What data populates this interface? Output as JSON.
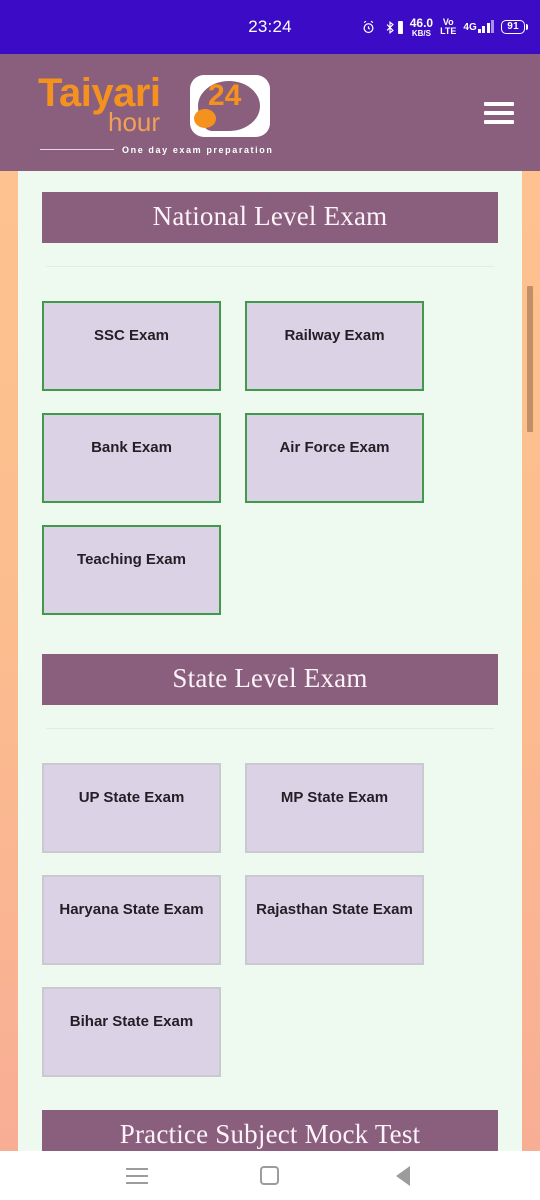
{
  "status_bar": {
    "time": "23:24",
    "alarm_icon": "alarm-clock-icon",
    "bluetooth_icon": "bluetooth-icon",
    "net_speed_value": "46.0",
    "net_speed_unit": "KB/S",
    "volte_line1": "Vo",
    "volte_line2": "LTE",
    "network_type": "4G",
    "battery_percent": "91",
    "background_color": "#3c0bc6"
  },
  "header": {
    "logo_name": "Taiyari",
    "logo_sub": "hour",
    "logo_badge_number": "24",
    "logo_tagline": "One day exam preparation",
    "menu_icon": "hamburger-menu-icon",
    "background_color": "#8a5f7e",
    "brand_orange": "#f5921e"
  },
  "page": {
    "background_color": "#eefaf0",
    "edge_gradient_color": "#fcbd8e",
    "card_fill": "#dcd2e6",
    "card_border_green": "#3f9b4b",
    "card_border_grey": "#c9c9cf",
    "banner_color": "#8a5f7e"
  },
  "sections": [
    {
      "title": "National Level Exam",
      "border_style": "green",
      "cards": [
        {
          "label": "SSC Exam"
        },
        {
          "label": "Railway Exam"
        },
        {
          "label": "Bank Exam"
        },
        {
          "label": "Air Force Exam"
        },
        {
          "label": "Teaching Exam"
        }
      ]
    },
    {
      "title": "State Level Exam",
      "border_style": "grey",
      "cards": [
        {
          "label": "UP State Exam"
        },
        {
          "label": "MP State Exam"
        },
        {
          "label": "Haryana State Exam"
        },
        {
          "label": "Rajasthan State Exam"
        },
        {
          "label": "Bihar State Exam"
        }
      ]
    },
    {
      "title": "Practice Subject Mock Test",
      "border_style": "none",
      "cards": []
    }
  ],
  "scrollbar": {
    "thumb_color": "#c08e69"
  },
  "nav_bar": {
    "recents_icon": "recents-menu-icon",
    "home_icon": "home-square-icon",
    "back_icon": "back-triangle-icon"
  }
}
